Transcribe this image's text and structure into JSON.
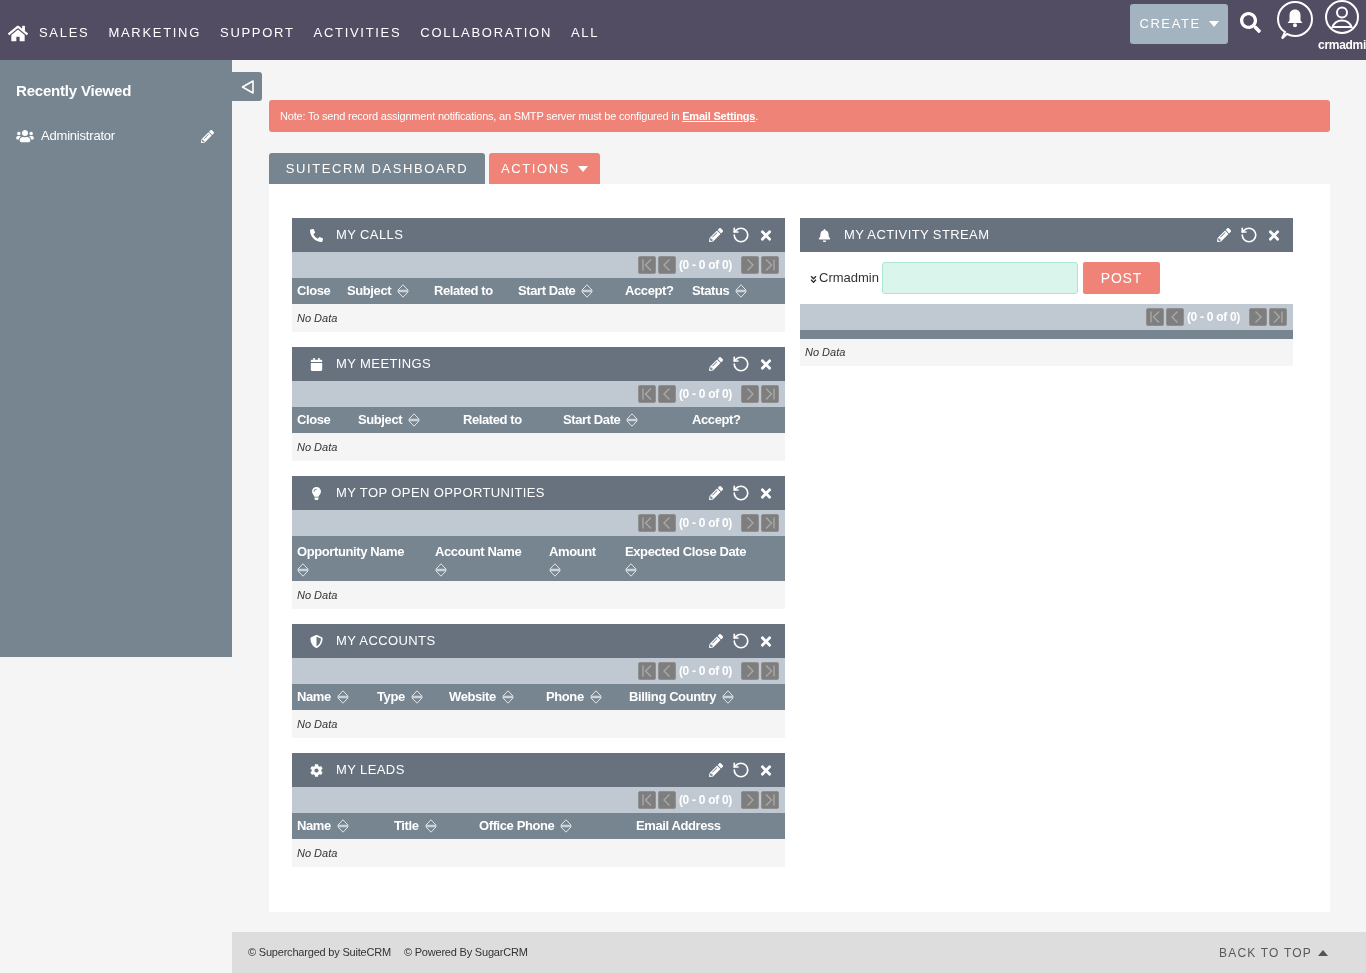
{
  "top_nav": {
    "menu_items": [
      "SALES",
      "MARKETING",
      "SUPPORT",
      "ACTIVITIES",
      "COLLABORATION",
      "ALL"
    ],
    "create_button": "CREATE",
    "user_name": "crmadmi"
  },
  "sidebar": {
    "title": "Recently Viewed",
    "items": [
      {
        "label": "Administrator"
      }
    ]
  },
  "notice": {
    "text": "Note: To send record assignment notifications, an SMTP server must be configured in ",
    "link": "Email Settings",
    "text_end": "."
  },
  "dashboard_tabs": [
    {
      "label": "SUITECRM DASHBOARD",
      "kind": "tab"
    },
    {
      "label": "ACTIONS",
      "kind": "dropdown"
    }
  ],
  "dashboard_columns": [
    {
      "dashlets": [
        {
          "title": "MY CALLS",
          "kind": "list",
          "pager": "(0 - 0 of 0)",
          "columns": [
            {
              "label": "Close",
              "sortable": false
            },
            {
              "label": "Subject",
              "sortable": true
            },
            {
              "label": "Related to",
              "sortable": false
            },
            {
              "label": "Start Date",
              "sortable": true
            },
            {
              "label": "Accept?",
              "sortable": false
            },
            {
              "label": "Status",
              "sortable": true
            }
          ],
          "empty_text": "No Data"
        },
        {
          "title": "MY MEETINGS",
          "kind": "list",
          "pager": "(0 - 0 of 0)",
          "columns": [
            {
              "label": "Close",
              "sortable": false
            },
            {
              "label": "Subject",
              "sortable": true
            },
            {
              "label": "Related to",
              "sortable": false
            },
            {
              "label": "Start Date",
              "sortable": true
            },
            {
              "label": "Accept?",
              "sortable": false
            }
          ],
          "empty_text": "No Data"
        },
        {
          "title": "MY TOP OPEN OPPORTUNITIES",
          "kind": "list",
          "pager": "(0 - 0 of 0)",
          "columns": [
            {
              "label": "Opportunity Name",
              "sortable": true
            },
            {
              "label": "Account Name",
              "sortable": true
            },
            {
              "label": "Amount",
              "sortable": true
            },
            {
              "label": "Expected Close Date",
              "sortable": true
            }
          ],
          "empty_text": "No Data"
        },
        {
          "title": "MY ACCOUNTS",
          "kind": "list",
          "pager": "(0 - 0 of 0)",
          "columns": [
            {
              "label": "Name",
              "sortable": true
            },
            {
              "label": "Type",
              "sortable": true
            },
            {
              "label": "Website",
              "sortable": true
            },
            {
              "label": "Phone",
              "sortable": true
            },
            {
              "label": "Billing Country",
              "sortable": true
            }
          ],
          "empty_text": "No Data"
        },
        {
          "title": "MY LEADS",
          "kind": "list",
          "pager": "(0 - 0 of 0)",
          "columns": [
            {
              "label": "Name",
              "sortable": true
            },
            {
              "label": "Title",
              "sortable": true
            },
            {
              "label": "Office Phone",
              "sortable": true
            },
            {
              "label": "Email Address",
              "sortable": false
            }
          ],
          "empty_text": "No Data"
        }
      ]
    },
    {
      "dashlets": [
        {
          "title": "MY ACTIVITY STREAM",
          "kind": "stream",
          "post_user": "Crmadmin",
          "post_button": "POST",
          "pager": "(0 - 0 of 0)",
          "empty_text": "No Data"
        }
      ]
    }
  ],
  "footer": {
    "credits": [
      "© Supercharged by SuiteCRM",
      "© Powered By SugarCRM"
    ],
    "back_to_top": "BACK TO TOP"
  }
}
